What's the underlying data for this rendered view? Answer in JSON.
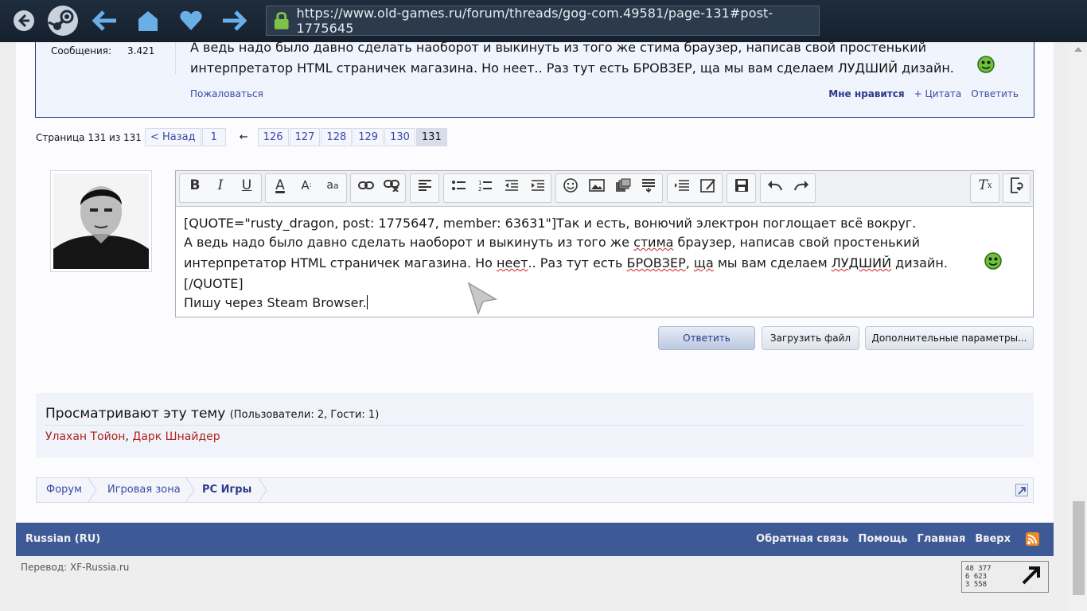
{
  "browser": {
    "url": "https://www.old-games.ru/forum/threads/gog-com.49581/page-131#post-1775645",
    "accent_color": "#1e2d3d"
  },
  "post": {
    "messages_label": "Сообщения:",
    "messages_value": "3.421",
    "line1": "А ведь надо было давно сделать наоборот и выкинуть из того же стима браузер, написав свой простенький",
    "line2": "интерпретатор HTML страничек магазина. Но неет.. Раз тут есть БРОВЗЕР, ща мы вам сделаем ЛУДШИЙ дизайн.",
    "report": "Пожаловаться",
    "like": "Мне нравится",
    "quote": "+ Цитата",
    "reply": "Ответить"
  },
  "pagenav": {
    "label": "Страница 131 из 131",
    "prev": "< Назад",
    "first": "1",
    "ellipsis_arrow": "←",
    "pages": [
      "126",
      "127",
      "128",
      "129",
      "130"
    ],
    "current": "131"
  },
  "editor": {
    "line1": "[QUOTE=\"rusty_dragon, post: 1775647, member: 63631\"]Так и есть, вонючий электрон поглощает всё вокруг.",
    "line2a": "А ведь надо было давно сделать наоборот и выкинуть из того же ",
    "line2b": "стима",
    "line2c": " браузер, написав свой простенький",
    "line3a": "интерпретатор HTML страничек магазина. Но ",
    "line3b": "неет",
    "line3c": ".. Раз тут есть ",
    "line3d": "БРОВЗЕР",
    "line3e": ", ",
    "line3f": "ща",
    "line3g": " мы вам сделаем ",
    "line3h": "ЛУДШИЙ",
    "line3i": " дизайн.",
    "line4": "[/QUOTE]",
    "line5": "Пишу через Steam Browser."
  },
  "buttons": {
    "reply": "Ответить",
    "upload": "Загрузить файл",
    "more": "Дополнительные параметры..."
  },
  "viewers": {
    "title": "Просматривают эту тему",
    "count": "(Пользователи: 2, Гости: 1)",
    "user1": "Улахан Тойон",
    "comma": ",",
    "user2": "Дарк Шнайдер"
  },
  "breadcrumb": {
    "items": [
      "Форум",
      "Игровая зона",
      "PC Игры"
    ]
  },
  "footer": {
    "lang": "Russian (RU)",
    "links": [
      "Обратная связь",
      "Помощь",
      "Главная",
      "Вверх"
    ],
    "credit": "Перевод: XF-Russia.ru",
    "counter": [
      "48 377",
      "6 623",
      "3 558"
    ]
  }
}
